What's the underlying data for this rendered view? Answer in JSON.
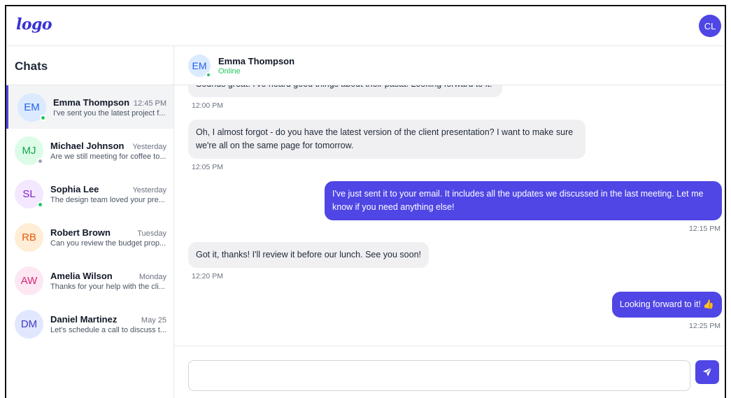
{
  "header": {
    "logo_text": "logo",
    "user_initials": "CL",
    "accent_color": "#4f46e5"
  },
  "sidebar": {
    "title": "Chats",
    "chats": [
      {
        "initials": "EM",
        "name": "Emma Thompson",
        "time": "12:45 PM",
        "preview": "I've sent you the latest project f...",
        "status": "online",
        "avatar_bg": "#dbeafe",
        "avatar_fg": "#2563eb",
        "active": true
      },
      {
        "initials": "MJ",
        "name": "Michael Johnson",
        "time": "Yesterday",
        "preview": "Are we still meeting for coffee to...",
        "status": "offline",
        "avatar_bg": "#dcfce7",
        "avatar_fg": "#16a34a",
        "active": false
      },
      {
        "initials": "SL",
        "name": "Sophia Lee",
        "time": "Yesterday",
        "preview": "The design team loved your pre...",
        "status": "online",
        "avatar_bg": "#f3e8ff",
        "avatar_fg": "#7e22ce",
        "active": false
      },
      {
        "initials": "RB",
        "name": "Robert Brown",
        "time": "Tuesday",
        "preview": "Can you review the budget prop...",
        "status": "none",
        "avatar_bg": "#ffedd5",
        "avatar_fg": "#ea580c",
        "active": false
      },
      {
        "initials": "AW",
        "name": "Amelia Wilson",
        "time": "Monday",
        "preview": "Thanks for your help with the cli...",
        "status": "none",
        "avatar_bg": "#fce7f3",
        "avatar_fg": "#db2777",
        "active": false
      },
      {
        "initials": "DM",
        "name": "Daniel Martinez",
        "time": "May 25",
        "preview": "Let's schedule a call to discuss t...",
        "status": "none",
        "avatar_bg": "#e0e7ff",
        "avatar_fg": "#4338ca",
        "active": false
      }
    ]
  },
  "conversation": {
    "contact_initials": "EM",
    "contact_name": "Emma Thompson",
    "contact_status": "Online",
    "messages": [
      {
        "direction": "in",
        "text": "Sounds great! I've heard good things about their pasta. Looking forward to it!",
        "time": "12:00 PM"
      },
      {
        "direction": "in",
        "text": "Oh, I almost forgot - do you have the latest version of the client presentation? I want to make sure we're all on the same page for tomorrow.",
        "time": "12:05 PM"
      },
      {
        "direction": "out",
        "text": "I've just sent it to your email. It includes all the updates we discussed in the last meeting. Let me know if you need anything else!",
        "time": "12:15 PM"
      },
      {
        "direction": "in",
        "text": "Got it, thanks! I'll review it before our lunch. See you soon!",
        "time": "12:20 PM"
      },
      {
        "direction": "out",
        "text": "Looking forward to it! 👍",
        "time": "12:25 PM"
      }
    ]
  },
  "composer": {
    "placeholder": "",
    "send_icon": "send-icon"
  }
}
